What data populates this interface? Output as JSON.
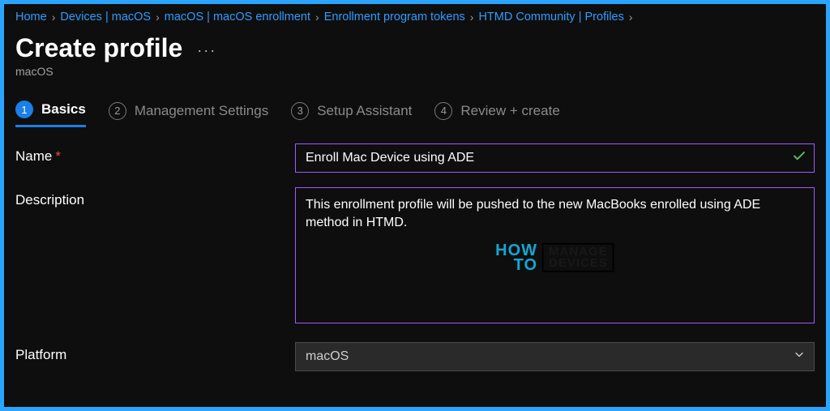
{
  "breadcrumb": [
    "Home",
    "Devices | macOS",
    "macOS | macOS enrollment",
    "Enrollment program tokens",
    "HTMD Community | Profiles"
  ],
  "header": {
    "title": "Create profile",
    "subtitle": "macOS",
    "more": "···"
  },
  "tabs": [
    {
      "num": "1",
      "label": "Basics"
    },
    {
      "num": "2",
      "label": "Management Settings"
    },
    {
      "num": "3",
      "label": "Setup Assistant"
    },
    {
      "num": "4",
      "label": "Review + create"
    }
  ],
  "form": {
    "name_label": "Name",
    "name_value": "Enroll Mac Device using ADE",
    "req_mark": "*",
    "description_label": "Description",
    "description_value": "This enrollment profile will be pushed to the new MacBooks enrolled using ADE method in HTMD.",
    "platform_label": "Platform",
    "platform_value": "macOS"
  },
  "watermark": {
    "how": "HOW",
    "to": "TO",
    "manage": "MANAGE",
    "devices": "DEVICES"
  }
}
